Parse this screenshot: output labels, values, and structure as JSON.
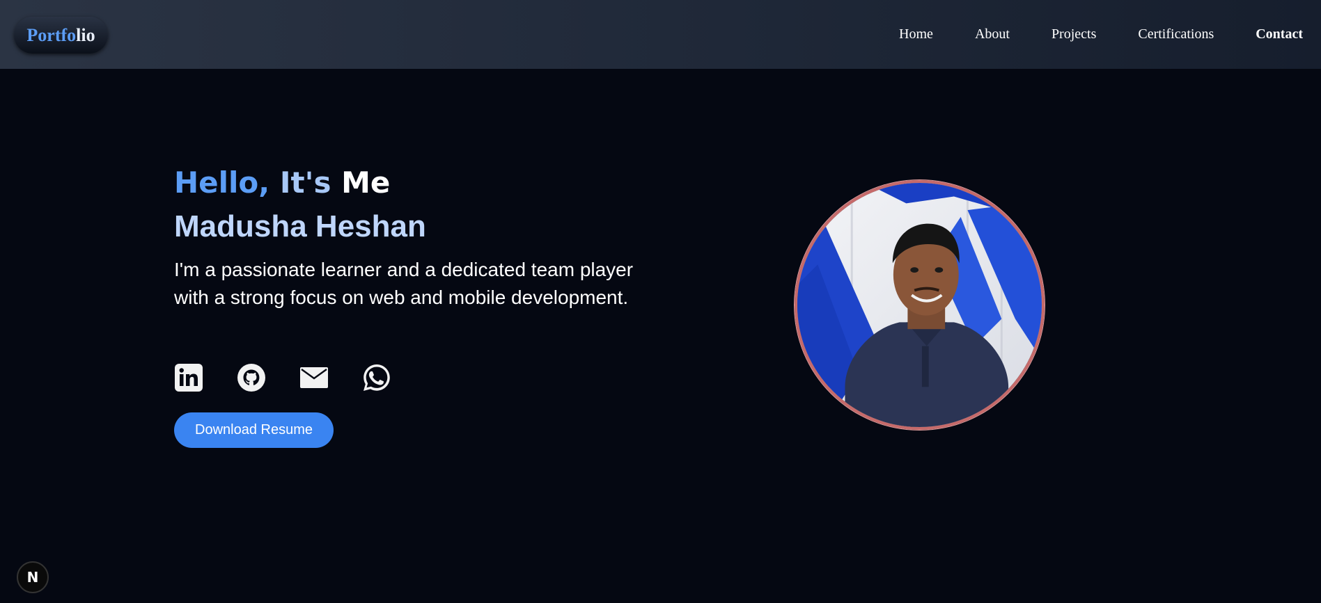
{
  "nav": {
    "logo_part1": "Portfo",
    "logo_part2": "lio",
    "links": [
      {
        "label": "Home"
      },
      {
        "label": "About"
      },
      {
        "label": "Projects"
      },
      {
        "label": "Certifications"
      },
      {
        "label": "Contact"
      }
    ]
  },
  "hero": {
    "greeting_part1": "Hello,",
    "greeting_part2": "It's",
    "greeting_part3": "Me",
    "name": "Madusha Heshan",
    "bio": "I'm a passionate learner and a dedicated team player with a strong focus on web and mobile development.",
    "resume_button": "Download Resume"
  },
  "socials": [
    {
      "icon": "linkedin-icon"
    },
    {
      "icon": "github-icon"
    },
    {
      "icon": "mail-icon"
    },
    {
      "icon": "whatsapp-icon"
    }
  ],
  "next_badge": "N",
  "colors": {
    "accent": "#3a84f1",
    "greeting_blue": "#5c9df5",
    "name_blue": "#bfd6fb",
    "background": "#050812",
    "navbar": "#1f2838",
    "profile_ring": "#c66a6a"
  }
}
